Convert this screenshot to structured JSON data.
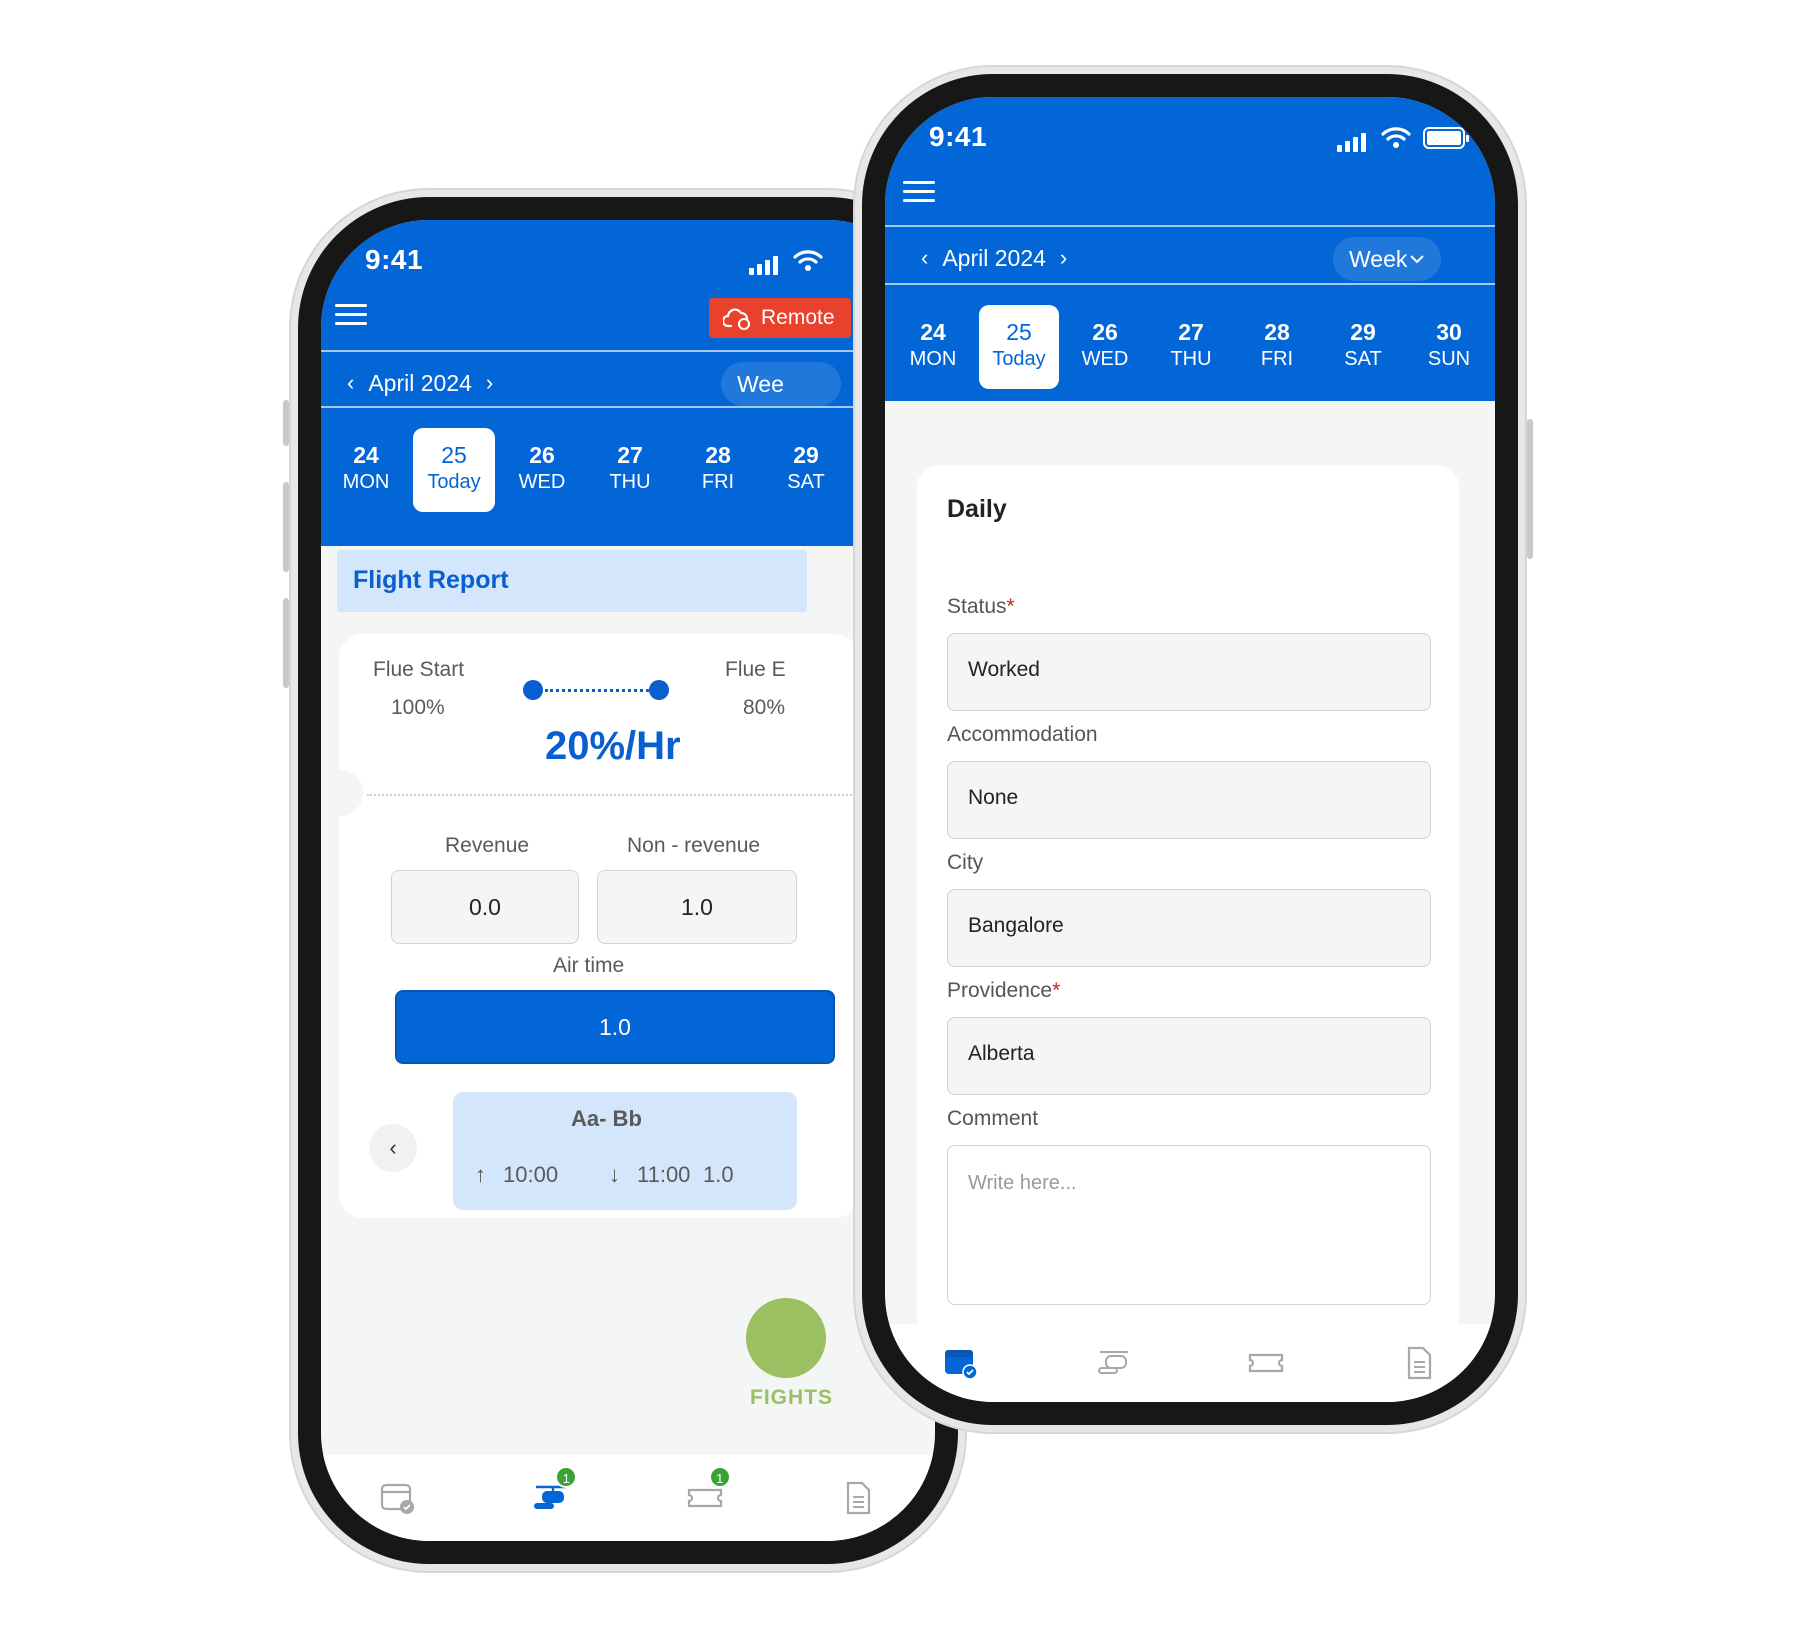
{
  "colors": {
    "primary": "#0366d6",
    "remote": "#e8412c",
    "fab": "#9ac062",
    "light_blue": "#d3e6fb"
  },
  "phone_a": {
    "status": {
      "time": "9:41"
    },
    "remote_button": {
      "label": "Remote",
      "icon": "cloud-sync-icon"
    },
    "month": "April 2024",
    "view_selector": "Wee",
    "days": [
      {
        "num": "24",
        "label": "MON"
      },
      {
        "num": "25",
        "label": "Today",
        "selected": true
      },
      {
        "num": "26",
        "label": "WED"
      },
      {
        "num": "27",
        "label": "THU"
      },
      {
        "num": "28",
        "label": "FRI"
      },
      {
        "num": "29",
        "label": "SAT"
      }
    ],
    "section_title": "Flight Report",
    "fuel": {
      "start_label": "Flue Start",
      "start_value": "100%",
      "end_label": "Flue E",
      "end_value": "80%",
      "rate": "20%/Hr"
    },
    "revenue": {
      "label": "Revenue",
      "value": "0.0"
    },
    "non_revenue": {
      "label": "Non - revenue",
      "value": "1.0"
    },
    "air_time": {
      "label": "Air time",
      "value": "1.0"
    },
    "leg": {
      "route": "Aa- Bb",
      "departure": "10:00",
      "arrival": "11:00",
      "duration": "1.0"
    },
    "fab_label": "FIGHTS",
    "tabs": [
      {
        "icon": "calendar-check-icon"
      },
      {
        "icon": "helicopter-icon",
        "badge": "1",
        "active": true
      },
      {
        "icon": "ticket-icon",
        "badge": "1"
      },
      {
        "icon": "document-icon"
      }
    ]
  },
  "phone_b": {
    "status": {
      "time": "9:41"
    },
    "month": "April 2024",
    "view_selector": "Week",
    "days": [
      {
        "num": "24",
        "label": "MON"
      },
      {
        "num": "25",
        "label": "Today",
        "selected": true
      },
      {
        "num": "26",
        "label": "WED"
      },
      {
        "num": "27",
        "label": "THU"
      },
      {
        "num": "28",
        "label": "FRI"
      },
      {
        "num": "29",
        "label": "SAT"
      },
      {
        "num": "30",
        "label": "SUN"
      }
    ],
    "form": {
      "title": "Daily",
      "status": {
        "label": "Status",
        "required": "*",
        "value": "Worked"
      },
      "accommodation": {
        "label": "Accommodation",
        "value": "None"
      },
      "city": {
        "label": "City",
        "value": "Bangalore"
      },
      "providence": {
        "label": "Providence",
        "required": "*",
        "value": "Alberta"
      },
      "comment": {
        "label": "Comment",
        "placeholder": "Write here..."
      }
    },
    "tabs": [
      {
        "icon": "calendar-check-icon",
        "active": true
      },
      {
        "icon": "helicopter-icon"
      },
      {
        "icon": "ticket-icon"
      },
      {
        "icon": "document-icon"
      }
    ]
  }
}
